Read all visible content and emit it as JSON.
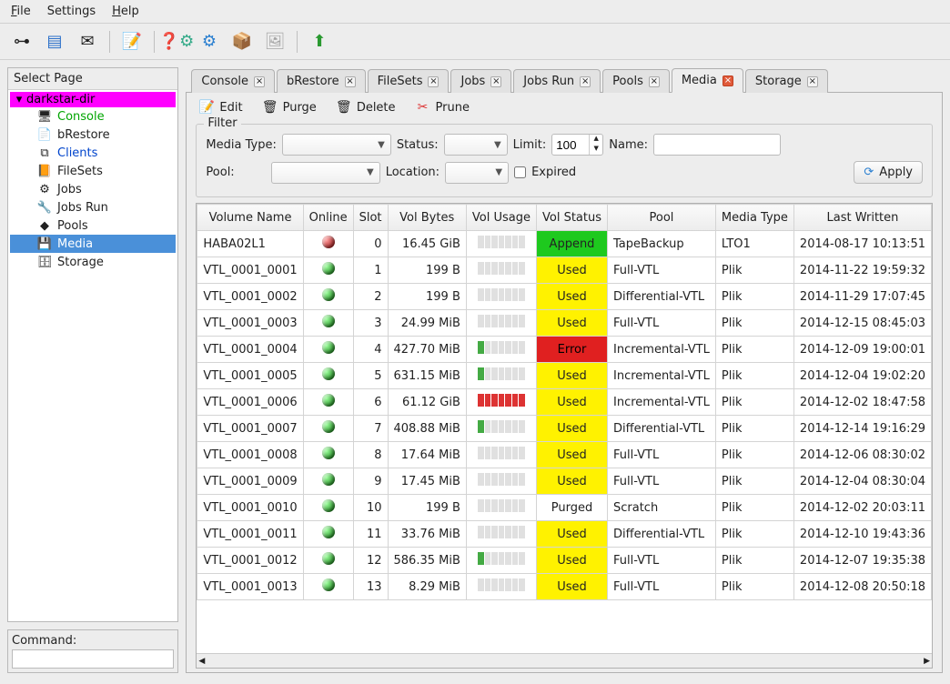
{
  "menu": {
    "file": "File",
    "settings": "Settings",
    "help": "Help"
  },
  "sidebar": {
    "title": "Select Page",
    "root": "darkstar-dir",
    "items": [
      {
        "label": "Console",
        "style": "green",
        "icon": "🖥"
      },
      {
        "label": "bRestore",
        "style": "",
        "icon": "📄"
      },
      {
        "label": "Clients",
        "style": "blue",
        "icon": "⧉"
      },
      {
        "label": "FileSets",
        "style": "",
        "icon": "📙"
      },
      {
        "label": "Jobs",
        "style": "",
        "icon": "⚙"
      },
      {
        "label": "Jobs Run",
        "style": "",
        "icon": "🔧"
      },
      {
        "label": "Pools",
        "style": "",
        "icon": "◆"
      },
      {
        "label": "Media",
        "style": "",
        "icon": "💾",
        "selected": true
      },
      {
        "label": "Storage",
        "style": "",
        "icon": "🗄"
      }
    ]
  },
  "command_label": "Command:",
  "tabs": [
    {
      "label": "Console"
    },
    {
      "label": "bRestore"
    },
    {
      "label": "FileSets"
    },
    {
      "label": "Jobs"
    },
    {
      "label": "Jobs Run"
    },
    {
      "label": "Pools"
    },
    {
      "label": "Media",
      "active": true
    },
    {
      "label": "Storage"
    }
  ],
  "actions": {
    "edit": "Edit",
    "purge": "Purge",
    "delete": "Delete",
    "prune": "Prune"
  },
  "filter": {
    "legend": "Filter",
    "media_type_label": "Media Type:",
    "status_label": "Status:",
    "limit_label": "Limit:",
    "limit_value": "100",
    "name_label": "Name:",
    "pool_label": "Pool:",
    "location_label": "Location:",
    "expired_label": "Expired",
    "apply": "Apply"
  },
  "table": {
    "headers": [
      "Volume Name",
      "Online",
      "Slot",
      "Vol Bytes",
      "Vol Usage",
      "Vol Status",
      "Pool",
      "Media Type",
      "Last Written"
    ],
    "rows": [
      {
        "name": "HABA02L1",
        "online": "red",
        "slot": 0,
        "bytes": "16.45 GiB",
        "usage": 0,
        "status": "Append",
        "status_class": "append",
        "pool": "TapeBackup",
        "mtype": "LTO1",
        "written": "2014-08-17 10:13:51"
      },
      {
        "name": "VTL_0001_0001",
        "online": "green",
        "slot": 1,
        "bytes": "199 B",
        "usage": 0,
        "status": "Used",
        "status_class": "used",
        "pool": "Full-VTL",
        "mtype": "Plik",
        "written": "2014-11-22 19:59:32"
      },
      {
        "name": "VTL_0001_0002",
        "online": "green",
        "slot": 2,
        "bytes": "199 B",
        "usage": 0,
        "status": "Used",
        "status_class": "used",
        "pool": "Differential-VTL",
        "mtype": "Plik",
        "written": "2014-11-29 17:07:45"
      },
      {
        "name": "VTL_0001_0003",
        "online": "green",
        "slot": 3,
        "bytes": "24.99 MiB",
        "usage": 0,
        "status": "Used",
        "status_class": "used",
        "pool": "Full-VTL",
        "mtype": "Plik",
        "written": "2014-12-15 08:45:03"
      },
      {
        "name": "VTL_0001_0004",
        "online": "green",
        "slot": 4,
        "bytes": "427.70 MiB",
        "usage": 1,
        "status": "Error",
        "status_class": "error",
        "pool": "Incremental-VTL",
        "mtype": "Plik",
        "written": "2014-12-09 19:00:01"
      },
      {
        "name": "VTL_0001_0005",
        "online": "green",
        "slot": 5,
        "bytes": "631.15 MiB",
        "usage": 1,
        "status": "Used",
        "status_class": "used",
        "pool": "Incremental-VTL",
        "mtype": "Plik",
        "written": "2014-12-04 19:02:20"
      },
      {
        "name": "VTL_0001_0006",
        "online": "green",
        "slot": 6,
        "bytes": "61.12 GiB",
        "usage": 7,
        "status": "Used",
        "status_class": "used",
        "pool": "Incremental-VTL",
        "mtype": "Plik",
        "written": "2014-12-02 18:47:58"
      },
      {
        "name": "VTL_0001_0007",
        "online": "green",
        "slot": 7,
        "bytes": "408.88 MiB",
        "usage": 1,
        "status": "Used",
        "status_class": "used",
        "pool": "Differential-VTL",
        "mtype": "Plik",
        "written": "2014-12-14 19:16:29"
      },
      {
        "name": "VTL_0001_0008",
        "online": "green",
        "slot": 8,
        "bytes": "17.64 MiB",
        "usage": 0,
        "status": "Used",
        "status_class": "used",
        "pool": "Full-VTL",
        "mtype": "Plik",
        "written": "2014-12-06 08:30:02"
      },
      {
        "name": "VTL_0001_0009",
        "online": "green",
        "slot": 9,
        "bytes": "17.45 MiB",
        "usage": 0,
        "status": "Used",
        "status_class": "used",
        "pool": "Full-VTL",
        "mtype": "Plik",
        "written": "2014-12-04 08:30:04"
      },
      {
        "name": "VTL_0001_0010",
        "online": "green",
        "slot": 10,
        "bytes": "199 B",
        "usage": 0,
        "status": "Purged",
        "status_class": "purged",
        "pool": "Scratch",
        "mtype": "Plik",
        "written": "2014-12-02 20:03:11"
      },
      {
        "name": "VTL_0001_0011",
        "online": "green",
        "slot": 11,
        "bytes": "33.76 MiB",
        "usage": 0,
        "status": "Used",
        "status_class": "used",
        "pool": "Differential-VTL",
        "mtype": "Plik",
        "written": "2014-12-10 19:43:36"
      },
      {
        "name": "VTL_0001_0012",
        "online": "green",
        "slot": 12,
        "bytes": "586.35 MiB",
        "usage": 1,
        "status": "Used",
        "status_class": "used",
        "pool": "Full-VTL",
        "mtype": "Plik",
        "written": "2014-12-07 19:35:38"
      },
      {
        "name": "VTL_0001_0013",
        "online": "green",
        "slot": 13,
        "bytes": "8.29 MiB",
        "usage": 0,
        "status": "Used",
        "status_class": "used",
        "pool": "Full-VTL",
        "mtype": "Plik",
        "written": "2014-12-08 20:50:18"
      }
    ]
  }
}
